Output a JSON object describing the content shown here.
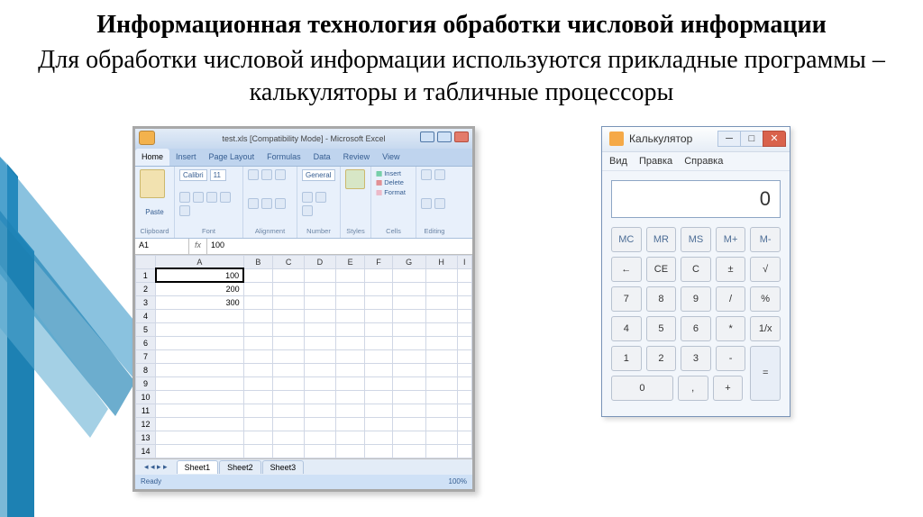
{
  "title": "Информационная технология обработки числовой информации",
  "subtitle": "Для обработки числовой информации используются прикладные программы – калькуляторы и табличные процессоры",
  "excel": {
    "window_title": "test.xls [Compatibility Mode] - Microsoft Excel",
    "tabs": [
      "Home",
      "Insert",
      "Page Layout",
      "Formulas",
      "Data",
      "Review",
      "View"
    ],
    "ribbon_groups": {
      "clipboard": "Clipboard",
      "font": "Font",
      "alignment": "Alignment",
      "number": "Number",
      "styles": "Styles",
      "cells": "Cells",
      "editing": "Editing"
    },
    "font_name": "Calibri",
    "font_size": "11",
    "number_fmt": "General",
    "cells_items": {
      "insert": "Insert",
      "delete": "Delete",
      "format": "Format"
    },
    "paste_label": "Paste",
    "name_box": "A1",
    "fx": "fx",
    "formula_value": "100",
    "columns": [
      "",
      "A",
      "B",
      "C",
      "D",
      "E",
      "F",
      "G",
      "H",
      "I"
    ],
    "rows": [
      {
        "n": "1",
        "a": "100"
      },
      {
        "n": "2",
        "a": "200"
      },
      {
        "n": "3",
        "a": "300"
      },
      {
        "n": "4",
        "a": ""
      },
      {
        "n": "5",
        "a": ""
      },
      {
        "n": "6",
        "a": ""
      },
      {
        "n": "7",
        "a": ""
      },
      {
        "n": "8",
        "a": ""
      },
      {
        "n": "9",
        "a": ""
      },
      {
        "n": "10",
        "a": ""
      },
      {
        "n": "11",
        "a": ""
      },
      {
        "n": "12",
        "a": ""
      },
      {
        "n": "13",
        "a": ""
      },
      {
        "n": "14",
        "a": ""
      }
    ],
    "sheets": [
      "Sheet1",
      "Sheet2",
      "Sheet3"
    ],
    "status_ready": "Ready",
    "zoom": "100%"
  },
  "calc": {
    "title": "Калькулятор",
    "menu": [
      "Вид",
      "Правка",
      "Справка"
    ],
    "display": "0",
    "rows": [
      [
        "MC",
        "MR",
        "MS",
        "M+",
        "M-"
      ],
      [
        "←",
        "CE",
        "C",
        "±",
        "√"
      ],
      [
        "7",
        "8",
        "9",
        "/",
        "%"
      ],
      [
        "4",
        "5",
        "6",
        "*",
        "1/x"
      ],
      [
        "1",
        "2",
        "3",
        "-",
        "="
      ],
      [
        "0",
        ",",
        "+"
      ]
    ]
  }
}
